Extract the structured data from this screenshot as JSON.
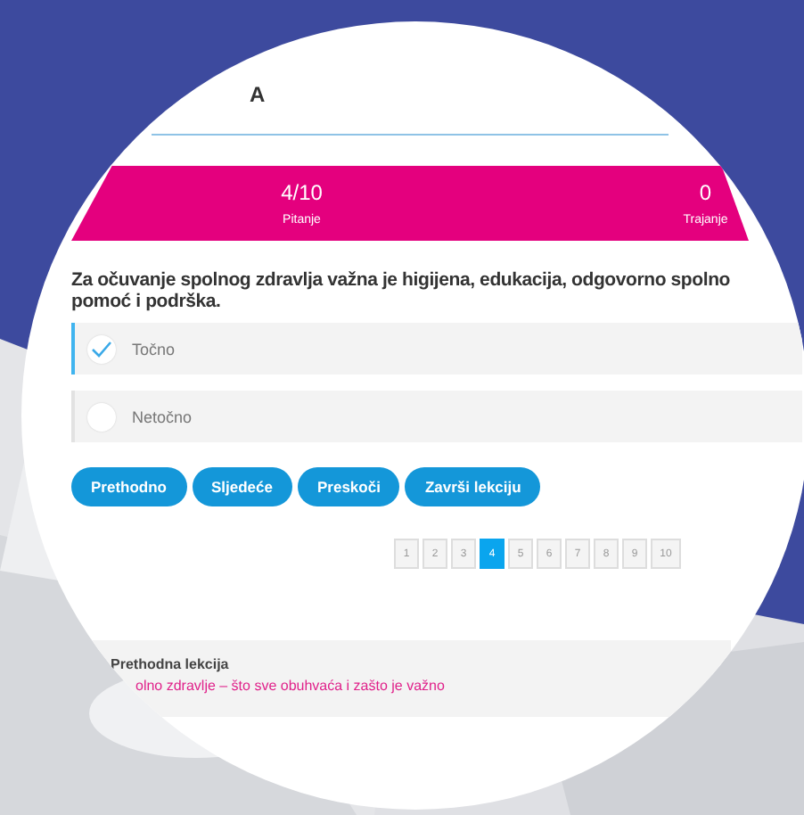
{
  "header": {
    "title": "A"
  },
  "progress": {
    "items": [
      {
        "value": "4/10",
        "label": "Pitanje"
      },
      {
        "value": "0",
        "label": "Trajanje"
      }
    ]
  },
  "question": {
    "text": "Za očuvanje spolnog zdravlja važna je higijena, edukacija, odgovorno spolno\npomoć i podrška."
  },
  "options": [
    {
      "label": "Točno",
      "selected": true
    },
    {
      "label": "Netočno",
      "selected": false
    }
  ],
  "buttons": [
    "Prethodno",
    "Sljedeće",
    "Preskoči",
    "Završi lekciju"
  ],
  "pagination": [
    {
      "label": "1",
      "selected": false
    },
    {
      "label": "2",
      "selected": false
    },
    {
      "label": "3",
      "selected": false
    },
    {
      "label": "4",
      "selected": true
    },
    {
      "label": "5",
      "selected": false
    },
    {
      "label": "6",
      "selected": false
    },
    {
      "label": "7",
      "selected": false
    },
    {
      "label": "8",
      "selected": false
    },
    {
      "label": "9",
      "selected": false
    },
    {
      "label": "10",
      "selected": false
    }
  ],
  "previous_lesson": {
    "heading": "Prethodna lekcija",
    "link": "olno zdravlje – što sve obuhvaća i zašto je važno"
  }
}
